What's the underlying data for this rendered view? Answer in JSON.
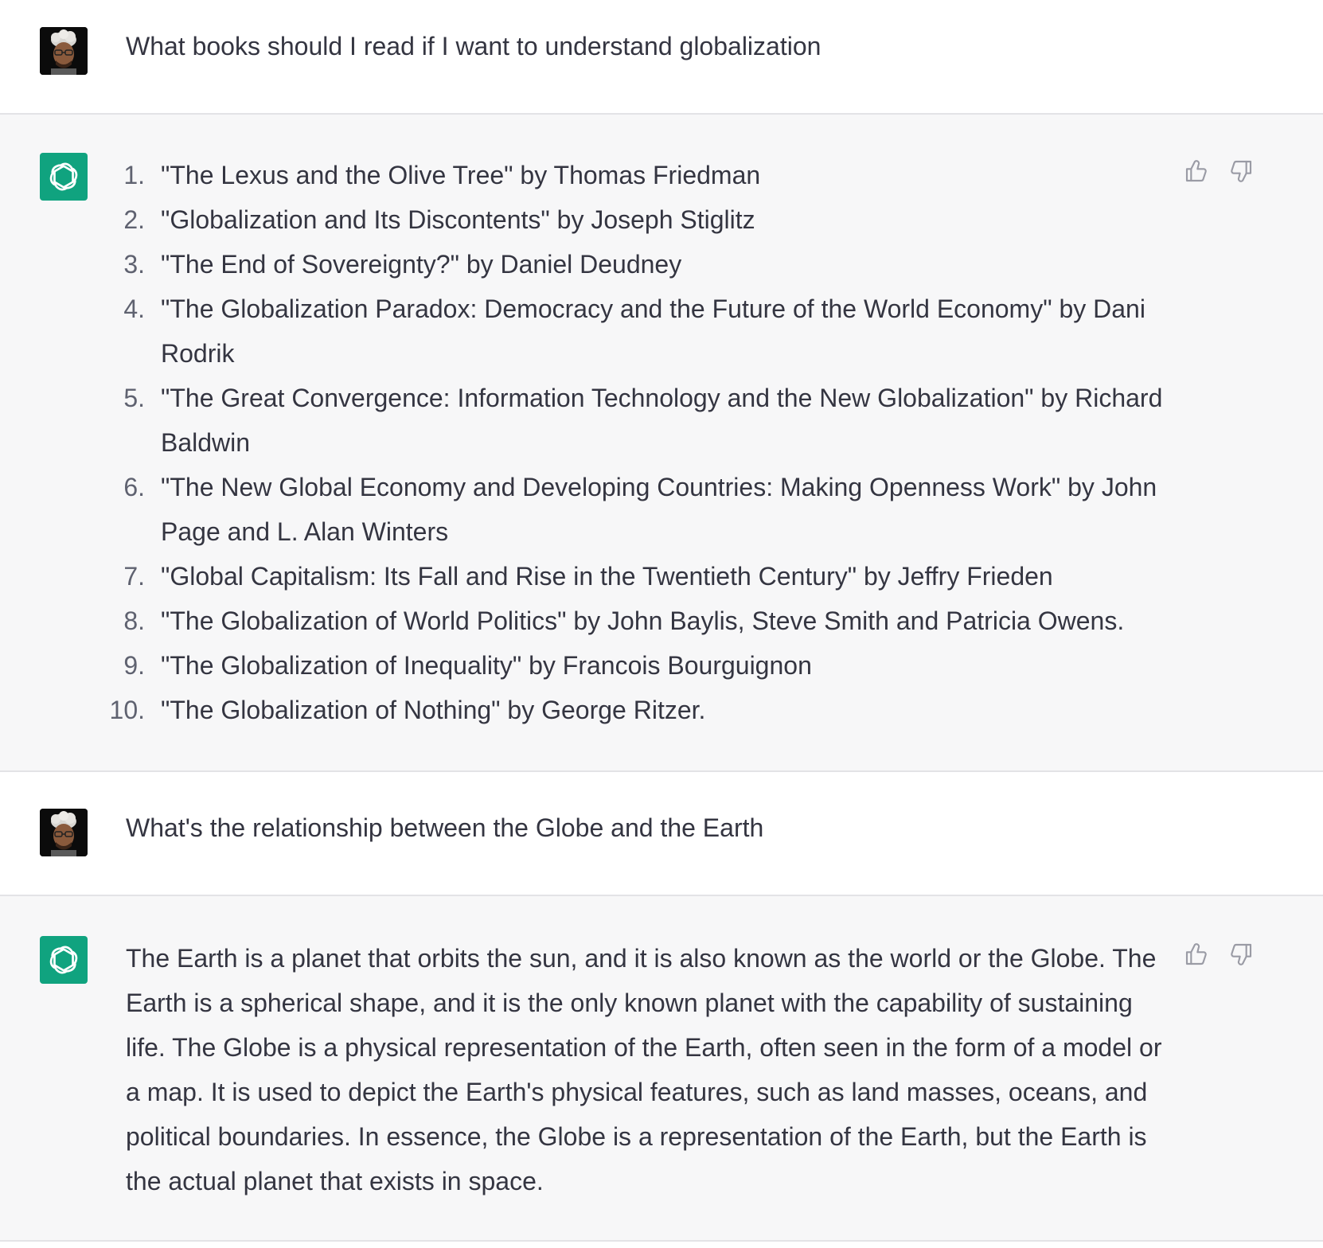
{
  "conversation": [
    {
      "role": "user",
      "avatar": "user-memoji-avatar",
      "text": "What books should I read if I want to understand globalization"
    },
    {
      "role": "assistant",
      "avatar": "openai-logo-icon",
      "list": [
        {
          "num": "1.",
          "text": "\"The Lexus and the Olive Tree\" by Thomas Friedman"
        },
        {
          "num": "2.",
          "text": "\"Globalization and Its Discontents\" by Joseph Stiglitz"
        },
        {
          "num": "3.",
          "text": "\"The End of Sovereignty?\" by Daniel Deudney"
        },
        {
          "num": "4.",
          "text": "\"The Globalization Paradox: Democracy and the Future of the World Economy\" by Dani Rodrik"
        },
        {
          "num": "5.",
          "text": "\"The Great Convergence: Information Technology and the New Globalization\" by Richard Baldwin"
        },
        {
          "num": "6.",
          "text": "\"The New Global Economy and Developing Countries: Making Openness Work\" by John Page and L. Alan Winters"
        },
        {
          "num": "7.",
          "text": "\"Global Capitalism: Its Fall and Rise in the Twentieth Century\" by Jeffry Frieden"
        },
        {
          "num": "8.",
          "text": "\"The Globalization of World Politics\" by John Baylis, Steve Smith and Patricia Owens."
        },
        {
          "num": "9.",
          "text": "\"The Globalization of Inequality\" by Francois Bourguignon"
        },
        {
          "num": "10.",
          "text": "\"The Globalization of Nothing\" by George Ritzer."
        }
      ],
      "feedback_icons": [
        "thumbs-up-icon",
        "thumbs-down-icon"
      ]
    },
    {
      "role": "user",
      "avatar": "user-memoji-avatar",
      "text": "What's the relationship between the Globe and the Earth"
    },
    {
      "role": "assistant",
      "avatar": "openai-logo-icon",
      "text": "The Earth is a planet that orbits the sun, and it is also known as the world or the Globe. The Earth is a spherical shape, and it is the only known planet with the capability of sustaining life. The Globe is a physical representation of the Earth, often seen in the form of a model or a map. It is used to depict the Earth's physical features, such as land masses, oceans, and political boundaries. In essence, the Globe is a representation of the Earth, but the Earth is the actual planet that exists in space.",
      "feedback_icons": [
        "thumbs-up-icon",
        "thumbs-down-icon"
      ]
    }
  ],
  "colors": {
    "gpt_green": "#10a37f",
    "assistant_bg": "#f7f7f8",
    "text": "#343541",
    "divider": "#e3e3e6"
  }
}
